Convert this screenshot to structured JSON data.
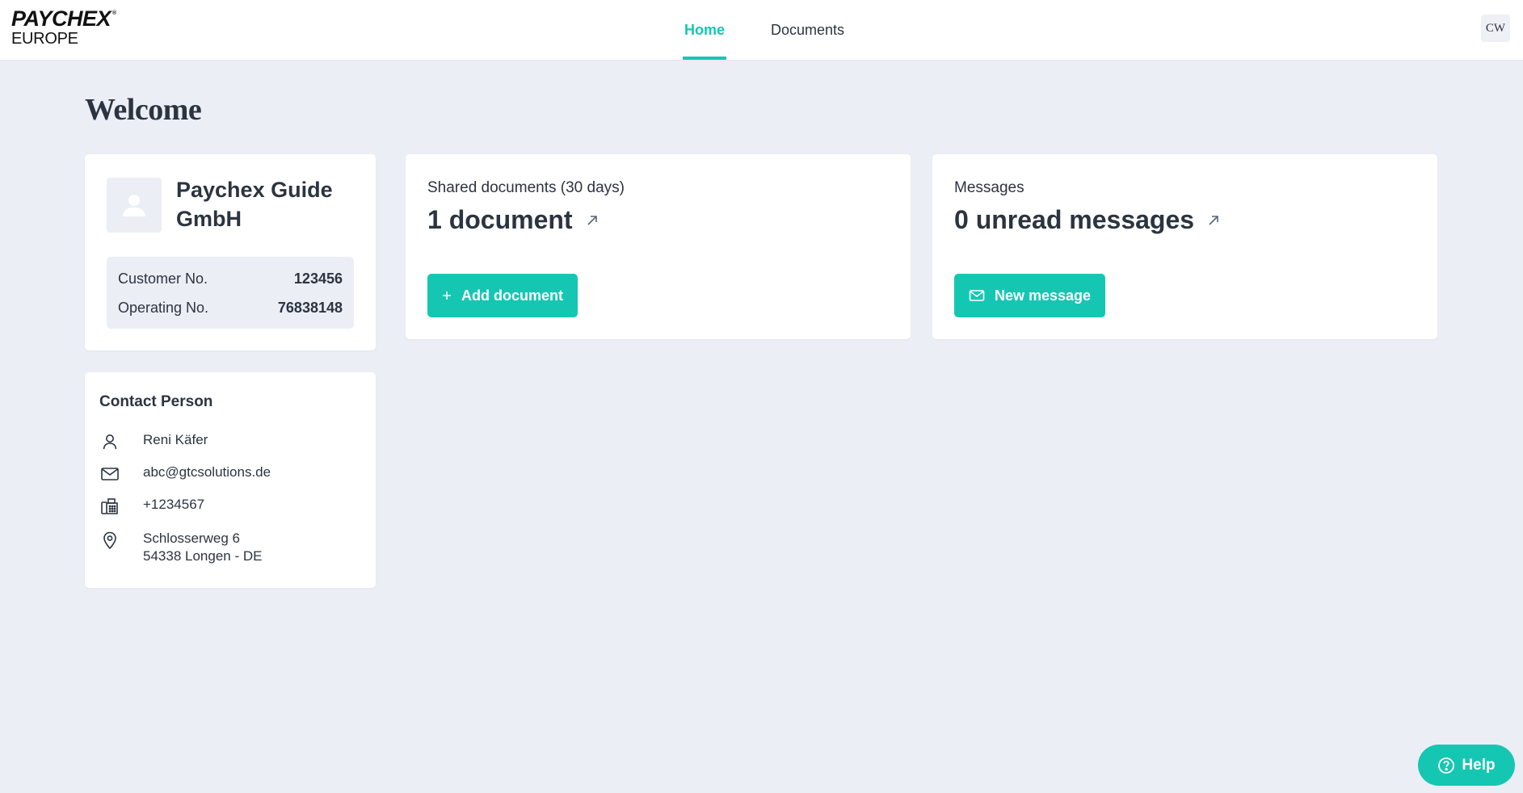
{
  "brand": {
    "line1": "PAYCHEX",
    "trademark": "®",
    "line2": "EUROPE"
  },
  "nav": {
    "tabs": [
      {
        "label": "Home",
        "active": true
      },
      {
        "label": "Documents",
        "active": false
      }
    ],
    "user_initials": "CW"
  },
  "page": {
    "title": "Welcome"
  },
  "company": {
    "name": "Paychex Guide GmbH",
    "customer_no_label": "Customer No.",
    "customer_no": "123456",
    "operating_no_label": "Operating No.",
    "operating_no": "76838148"
  },
  "contact": {
    "title": "Contact Person",
    "name": "Reni Käfer",
    "email": "abc@gtcsolutions.de",
    "phone": "+1234567",
    "address_line1": "Schlosserweg 6",
    "address_line2": "54338 Longen - DE"
  },
  "shared_documents": {
    "label": "Shared documents (30 days)",
    "summary": "1 document",
    "button_label": "Add document"
  },
  "messages": {
    "label": "Messages",
    "summary": "0 unread messages",
    "button_label": "New message"
  },
  "help": {
    "label": "Help"
  },
  "colors": {
    "accent": "#15c7b2",
    "background": "#eceef5",
    "text": "#2b3440"
  },
  "icons": {
    "company_avatar": "user-placeholder-icon",
    "person": "person-icon",
    "email": "envelope-icon",
    "phone": "fax-phone-icon",
    "address": "location-pin-icon",
    "external": "arrow-up-right-icon",
    "add": "plus-icon",
    "message": "envelope-icon",
    "help": "question-circle-icon"
  }
}
